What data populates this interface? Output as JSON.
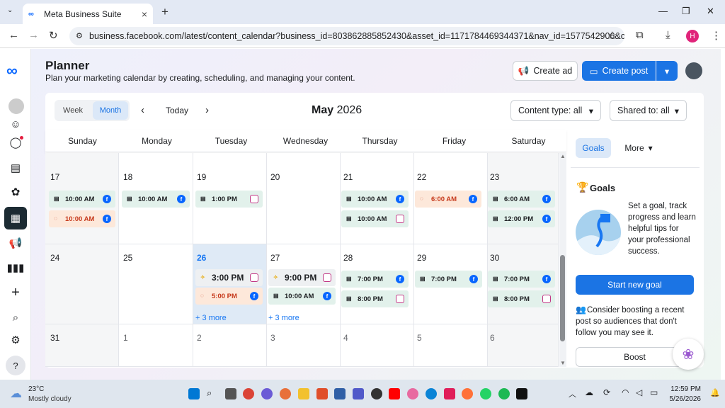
{
  "browser": {
    "tab_title": "Meta Business Suite",
    "url": "business.facebook.com/latest/content_calendar?business_id=803862885852430&asset_id=1171784469344371&nav_id=1577542906&calendar_t...",
    "profile_initial": "H"
  },
  "header": {
    "title": "Planner",
    "subtitle": "Plan your marketing calendar by creating, scheduling, and managing your content.",
    "create_ad": "Create ad",
    "create_post": "Create post"
  },
  "toolbar": {
    "week": "Week",
    "month": "Month",
    "today": "Today",
    "month_label": "May",
    "year_label": "2026",
    "content_type": "Content type: all",
    "shared_to": "Shared to: all"
  },
  "days": [
    "Sunday",
    "Monday",
    "Tuesday",
    "Wednesday",
    "Thursday",
    "Friday",
    "Saturday"
  ],
  "weeks": [
    {
      "dates": [
        "17",
        "18",
        "19",
        "20",
        "21",
        "22",
        "23"
      ]
    },
    {
      "dates": [
        "24",
        "25",
        "26",
        "27",
        "28",
        "29",
        "30"
      ]
    },
    {
      "dates": [
        "31",
        "1",
        "2",
        "3",
        "4",
        "5",
        "6"
      ]
    }
  ],
  "events": {
    "e17a": "10:00 AM",
    "e17b": "10:00 AM",
    "e18a": "10:00 AM",
    "e19a": "1:00 PM",
    "e21a": "10:00 AM",
    "e21b": "10:00 AM",
    "e22a": "6:00 AM",
    "e23a": "6:00 AM",
    "e23b": "12:00 PM",
    "e26a": "3:00 PM",
    "e26b": "5:00 PM",
    "e27a": "9:00 PM",
    "e27b": "10:00 AM",
    "e28a": "7:00 PM",
    "e28b": "8:00 PM",
    "e29a": "7:00 PM",
    "e30a": "7:00 PM",
    "e30b": "8:00 PM",
    "more26": "+ 3 more",
    "more27": "+ 3 more"
  },
  "sidepanel": {
    "tab_goals": "Goals",
    "tab_more": "More",
    "goals_title": "Goals",
    "goals_text": "Set a goal, track progress and learn helpful tips for your professional success.",
    "start_goal": "Start new goal",
    "boost_text": "Consider boosting a recent post so audiences that don't follow you may see it.",
    "boost": "Boost"
  },
  "taskbar": {
    "temp": "23°C",
    "weather": "Mostly cloudy",
    "time": "12:59 PM",
    "date": "5/26/2026"
  },
  "colors": {
    "accent": "#0866ff",
    "primary_button": "#1b74e4",
    "nav_active": "#1c2b33",
    "today_cell": "#dfeaf6"
  }
}
